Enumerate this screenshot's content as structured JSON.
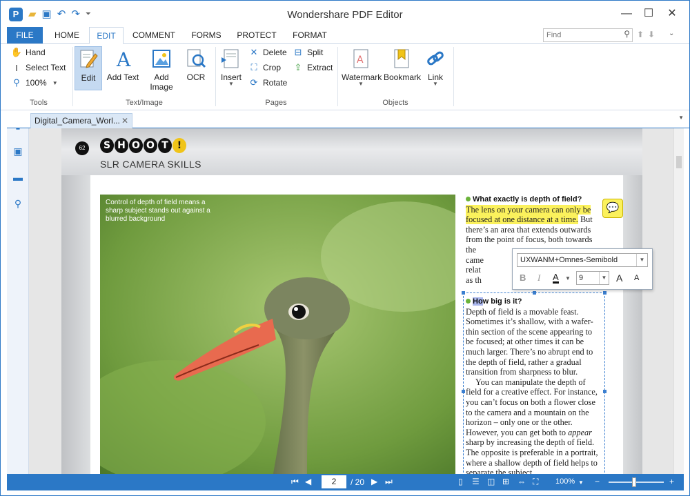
{
  "app": {
    "title": "Wondershare PDF Editor",
    "accent": "#2b78c6"
  },
  "menu": {
    "file": "FILE",
    "tabs": [
      "HOME",
      "EDIT",
      "COMMENT",
      "FORMS",
      "PROTECT",
      "FORMAT"
    ],
    "active_tab": "EDIT",
    "find_placeholder": "Find"
  },
  "ribbon": {
    "tools": {
      "hand": "Hand",
      "select_text": "Select Text",
      "zoom": "100%",
      "label": "Tools"
    },
    "text_image": {
      "edit": "Edit",
      "add_text": "Add Text",
      "add_image": "Add Image",
      "ocr": "OCR",
      "label": "Text/Image"
    },
    "pages": {
      "insert": "Insert",
      "delete": "Delete",
      "crop": "Crop",
      "rotate": "Rotate",
      "split": "Split",
      "extract": "Extract",
      "label": "Pages"
    },
    "objects": {
      "watermark": "Watermark",
      "bookmark": "Bookmark",
      "link": "Link",
      "label": "Objects"
    }
  },
  "document": {
    "tab_name": "Digital_Camera_Worl...",
    "page_number_badge": "62",
    "shoot_letters": [
      "S",
      "H",
      "O",
      "O",
      "T",
      "!"
    ],
    "section": "SLR CAMERA SKILLS",
    "caption": "Control of depth of field means a sharp subject stands out against a blurred background",
    "q1_heading": "What exactly is depth of field?",
    "q1_highlight": "The lens on your camera can only be focused at one distance at a time.",
    "q1_rest": " But there’s an area that extends outwards from the point of focus, both towards the",
    "q1_partial_1": "came",
    "q1_partial_2": "relat",
    "q1_partial_3": "as th",
    "q2_heading_selected": "Ho",
    "q2_heading_rest": "w big is it?",
    "q2_para1": "Depth of field is a movable feast. Sometimes it’s shallow, with a wafer-thin section of the scene appearing to be focused; at other times it can be much larger. There’s no abrupt end to the depth of field, rather a gradual transition from sharpness to blur.",
    "q2_para2_a": "You can manipulate the depth of field for a creative effect. For instance, you can’t focus on both a flower close to the camera and a mountain on the horizon – only one or the other. However, you can get both to ",
    "q2_para2_em": "appear",
    "q2_para2_b": " sharp by increasing the depth of field. The opposite is preferable in a portrait, where a shallow depth of field helps to separate the subject"
  },
  "font_popup": {
    "font_name": "UXWANM+Omnes-Semibold",
    "bold": "B",
    "italic": "I",
    "color_letter": "A",
    "size": "9",
    "grow": "A",
    "shrink": "A"
  },
  "status": {
    "current_page": "2",
    "page_total": "/ 20",
    "zoom": "100%"
  }
}
